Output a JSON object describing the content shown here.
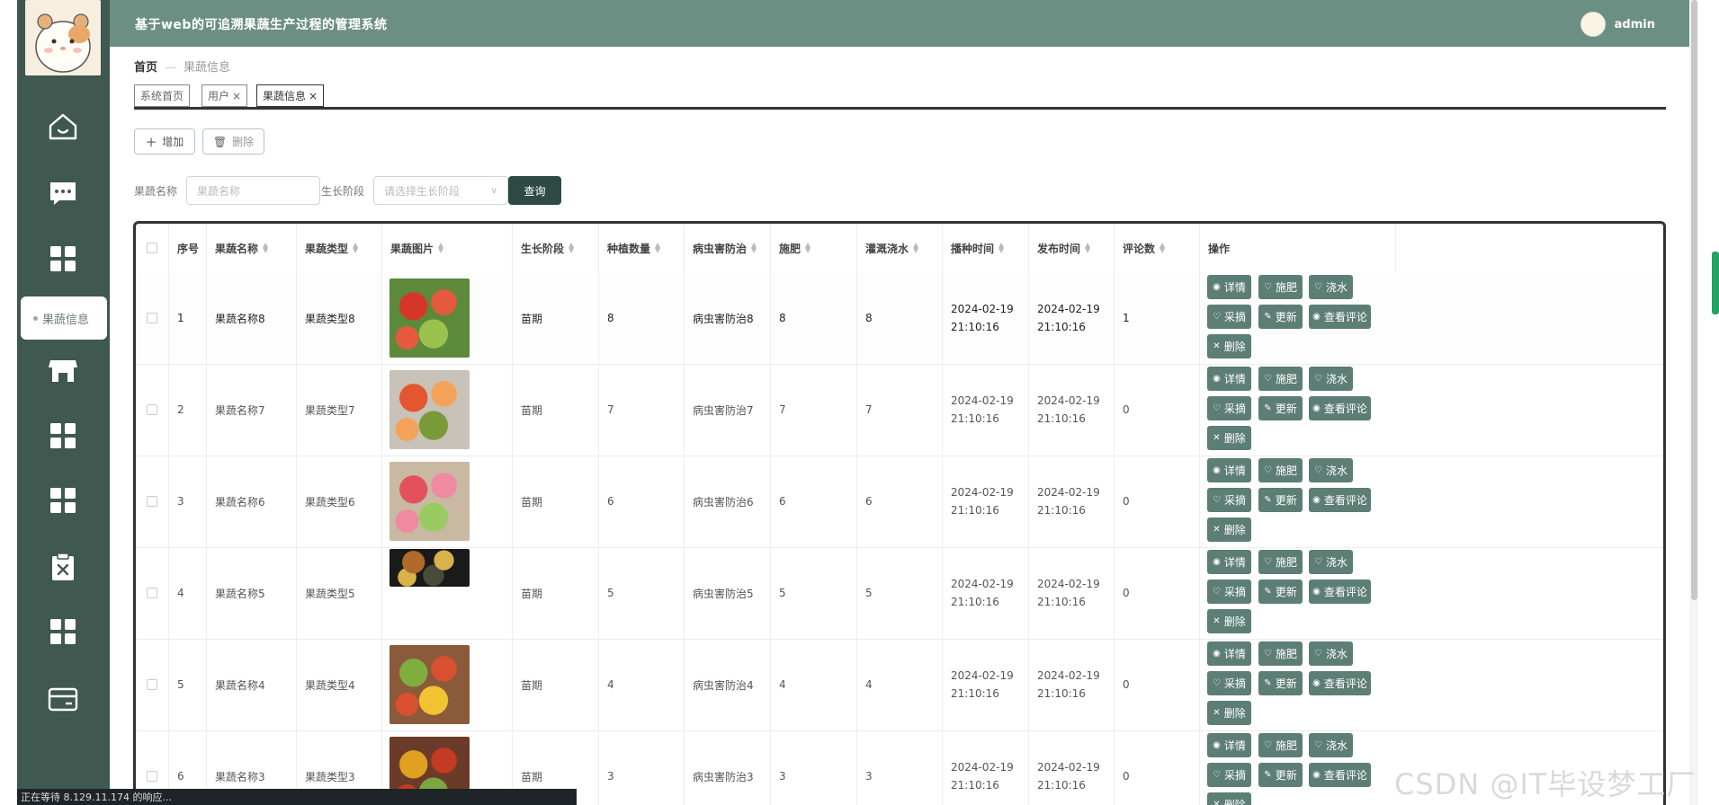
{
  "header": {
    "title": "基于web的可追溯果蔬生产过程的管理系统",
    "username": "admin"
  },
  "sidebar": {
    "icons": [
      "home-icon",
      "message-icon",
      "grid-icon",
      "shop-icon",
      "grid-icon",
      "grid-icon",
      "clipboard-x-icon",
      "grid-icon",
      "card-icon"
    ],
    "active_label": "果蔬信息"
  },
  "breadcrumb": {
    "home": "首页",
    "separator": "—",
    "current": "果蔬信息"
  },
  "tabs": [
    {
      "label": "系统首页",
      "closable": false
    },
    {
      "label": "用户",
      "closable": true
    },
    {
      "label": "果蔬信息",
      "closable": true
    }
  ],
  "toolbar": {
    "add_label": "增加",
    "delete_label": "删除"
  },
  "search": {
    "name_label": "果蔬名称",
    "name_placeholder": "果蔬名称",
    "stage_label": "生长阶段",
    "stage_placeholder": "请选择生长阶段",
    "query_label": "查询"
  },
  "table": {
    "headers": [
      "序号",
      "果蔬名称",
      "果蔬类型",
      "果蔬图片",
      "生长阶段",
      "种植数量",
      "病虫害防治",
      "施肥",
      "灌溉浇水",
      "播种时间",
      "发布时间",
      "评论数",
      "操作"
    ],
    "rows": [
      {
        "index": "1",
        "name": "果蔬名称8",
        "type": "果蔬类型8",
        "stage": "苗期",
        "qty": "8",
        "pest": "病虫害防治8",
        "fert": "8",
        "water": "8",
        "sow_time": "2024-02-19 21:10:16",
        "pub_time": "2024-02-19 21:10:16",
        "comments": "1"
      },
      {
        "index": "2",
        "name": "果蔬名称7",
        "type": "果蔬类型7",
        "stage": "苗期",
        "qty": "7",
        "pest": "病虫害防治7",
        "fert": "7",
        "water": "7",
        "sow_time": "2024-02-19 21:10:16",
        "pub_time": "2024-02-19 21:10:16",
        "comments": "0"
      },
      {
        "index": "3",
        "name": "果蔬名称6",
        "type": "果蔬类型6",
        "stage": "苗期",
        "qty": "6",
        "pest": "病虫害防治6",
        "fert": "6",
        "water": "6",
        "sow_time": "2024-02-19 21:10:16",
        "pub_time": "2024-02-19 21:10:16",
        "comments": "0"
      },
      {
        "index": "4",
        "name": "果蔬名称5",
        "type": "果蔬类型5",
        "stage": "苗期",
        "qty": "5",
        "pest": "病虫害防治5",
        "fert": "5",
        "water": "5",
        "sow_time": "2024-02-19 21:10:16",
        "pub_time": "2024-02-19 21:10:16",
        "comments": "0"
      },
      {
        "index": "5",
        "name": "果蔬名称4",
        "type": "果蔬类型4",
        "stage": "苗期",
        "qty": "4",
        "pest": "病虫害防治4",
        "fert": "4",
        "water": "4",
        "sow_time": "2024-02-19 21:10:16",
        "pub_time": "2024-02-19 21:10:16",
        "comments": "0"
      },
      {
        "index": "6",
        "name": "果蔬名称3",
        "type": "果蔬类型3",
        "stage": "苗期",
        "qty": "3",
        "pest": "病虫害防治3",
        "fert": "3",
        "water": "3",
        "sow_time": "2024-02-19 21:10:16",
        "pub_time": "2024-02-19 21:10:16",
        "comments": "0"
      }
    ],
    "ops": [
      "详情",
      "施肥",
      "浇水",
      "采摘",
      "更新",
      "查看评论",
      "删除"
    ]
  },
  "statusbar": {
    "text": "正在等待 8.129.11.174 的响应..."
  },
  "watermark": {
    "text": "CSDN @IT毕设梦工厂"
  },
  "colors": {
    "sidebar": "#3f5850",
    "header": "#6c8f84",
    "op_button": "#5d7e74",
    "query_button": "#2f4a43"
  }
}
